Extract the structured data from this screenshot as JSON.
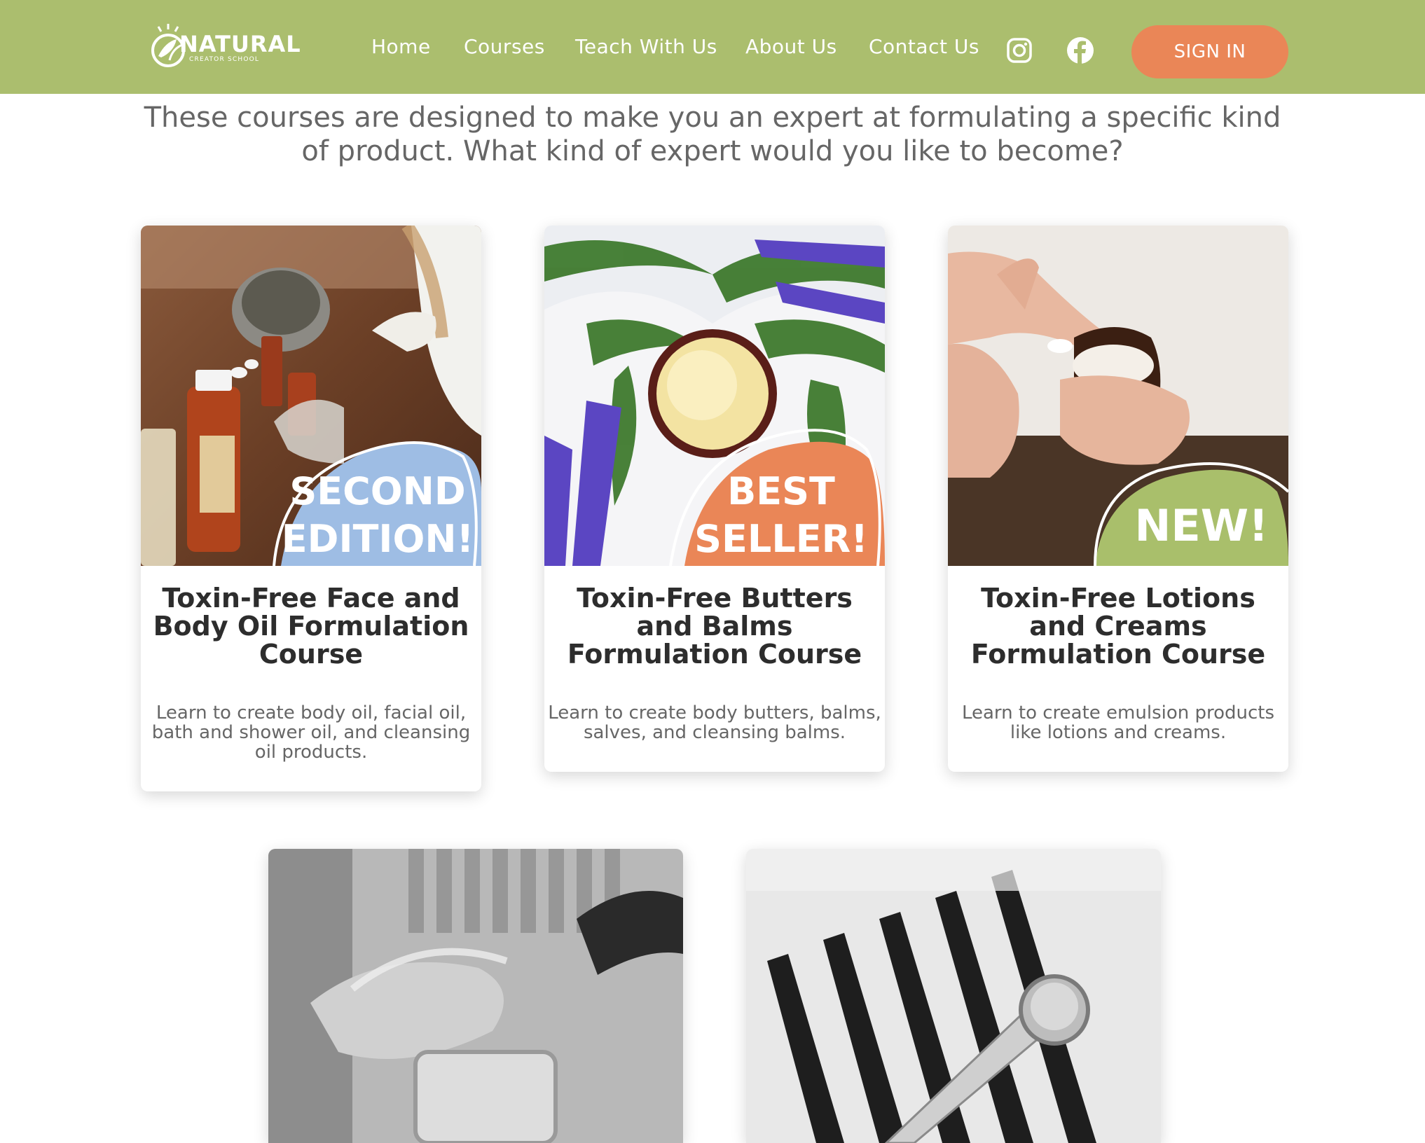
{
  "brand": {
    "name": "NATURAL",
    "tagline": "CREATOR SCHOOL",
    "green": "#abbe6e",
    "orange": "#ea8657",
    "blue": "#9ebde4"
  },
  "nav": {
    "items": [
      "Home",
      "Courses",
      "Teach With Us",
      "About Us",
      "Contact Us"
    ],
    "social": [
      "instagram-icon",
      "facebook-icon"
    ],
    "signin_label": "SIGN IN"
  },
  "intro": {
    "text": "These courses are designed to make you an expert at formulating a specific kind of product. What kind of expert would you like to become?"
  },
  "courses": [
    {
      "badge_lines": [
        "SECOND",
        "EDITION!"
      ],
      "badge_color": "#9ebde4",
      "title": "Toxin-Free Face and Body Oil Formulation Course",
      "description": "Learn to create body oil, facial oil, bath and shower oil, and cleansing oil products."
    },
    {
      "badge_lines": [
        "BEST",
        "SELLER!"
      ],
      "badge_color": "#ea8657",
      "title": "Toxin-Free Butters and Balms Formulation Course",
      "description": "Learn to create body butters, balms, salves, and cleansing balms."
    },
    {
      "badge_lines": [
        "NEW!"
      ],
      "badge_color": "#a9bf6b",
      "title": "Toxin-Free Lotions and Creams Formulation Course",
      "description": "Learn to create emulsion products like lotions and creams."
    }
  ]
}
